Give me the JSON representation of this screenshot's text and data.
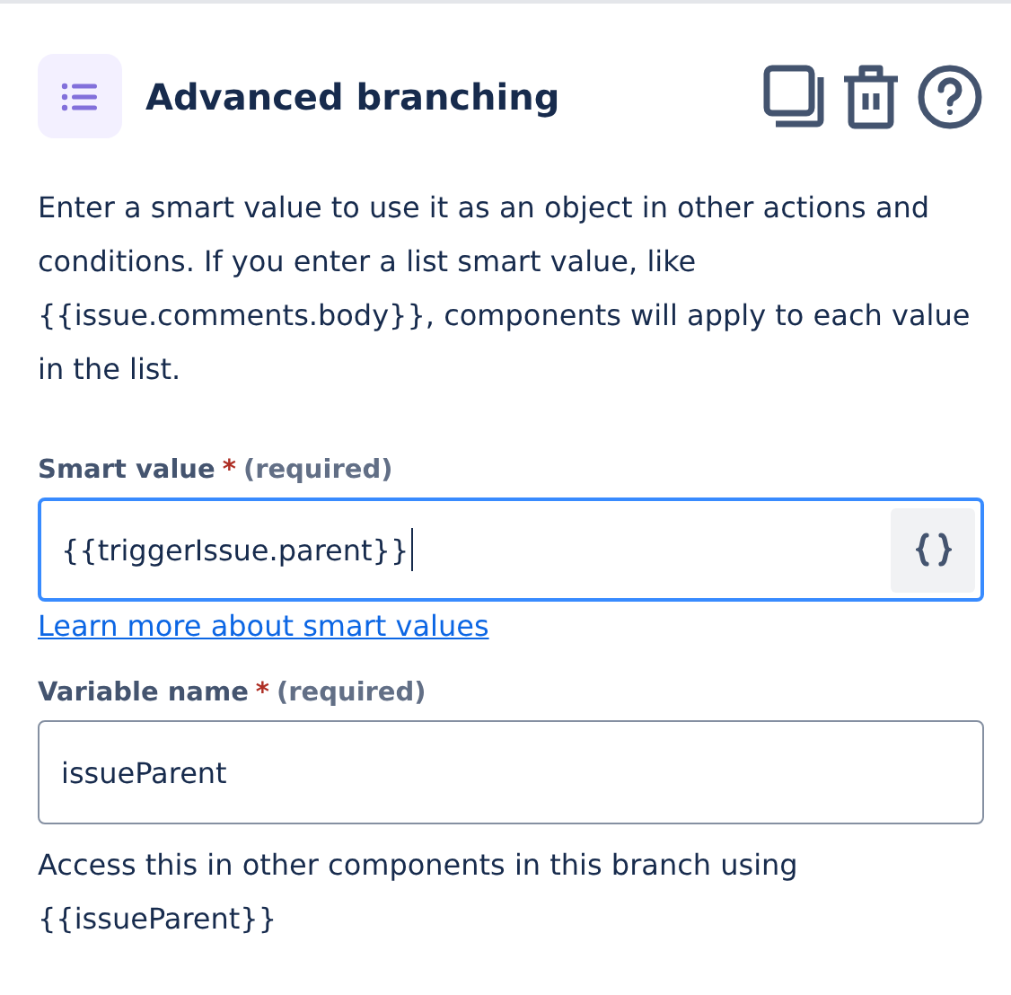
{
  "header": {
    "title": "Advanced branching"
  },
  "description": "Enter a smart value to use it as an object in other actions and conditions. If you enter a list smart value, like {{issue.comments.body}}, components will apply to each value in the list.",
  "fields": [
    {
      "label": "Smart value",
      "required_mark": "*",
      "required_text": "(required)",
      "value": "{{triggerIssue.parent}}",
      "focused": true,
      "has_insert_button": true,
      "link": "Learn more about smart values"
    },
    {
      "label": "Variable name",
      "required_mark": "*",
      "required_text": "(required)",
      "value": "issueParent",
      "focused": false,
      "has_insert_button": false,
      "help": "Access this in other components in this branch using {{issueParent}}"
    }
  ]
}
